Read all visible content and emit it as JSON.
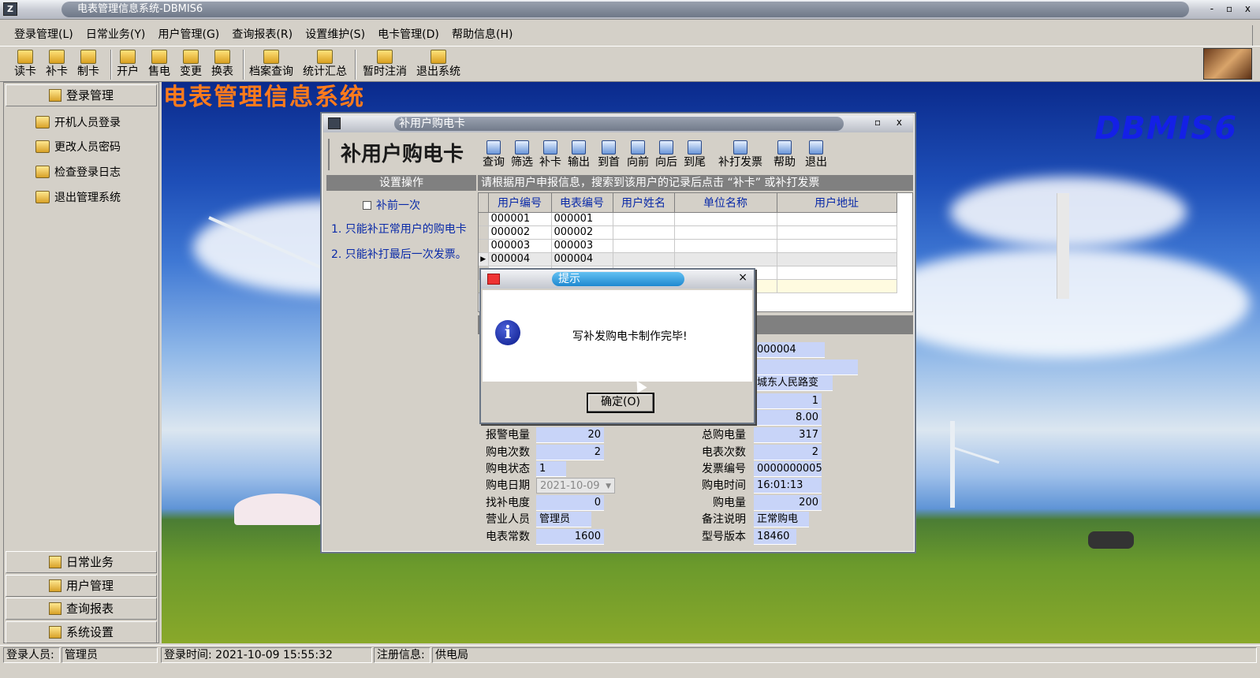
{
  "window": {
    "title": "电表管理信息系统-DBMIS6",
    "logo": "Z",
    "controls": "- ▫ x"
  },
  "menu": [
    "登录管理(L)",
    "日常业务(Y)",
    "用户管理(G)",
    "查询报表(R)",
    "设置维护(S)",
    "电卡管理(D)",
    "帮助信息(H)"
  ],
  "toolbar": {
    "read": "读卡",
    "reissue": "补卡",
    "make": "制卡",
    "open": "开户",
    "sell": "售电",
    "change": "变更",
    "swap": "换表",
    "archive": "档案查询",
    "stats": "统计汇总",
    "logout": "暂时注消",
    "exit": "退出系统"
  },
  "sidebar": {
    "top_header": "登录管理",
    "items": [
      "开机人员登录",
      "更改人员密码",
      "检查登录日志",
      "退出管理系统"
    ],
    "bottom_headers": [
      "日常业务",
      "用户管理",
      "查询报表",
      "系统设置"
    ]
  },
  "desktop": {
    "app_title": "电表管理信息系统",
    "brand": "DBMIS6"
  },
  "child": {
    "title": "补用户购电卡",
    "controls": "▫ x",
    "form_title": "补用户购电卡",
    "toolbar": {
      "query": "查询",
      "filter": "筛选",
      "reissue": "补卡",
      "export": "输出",
      "first": "到首",
      "prev": "向前",
      "next": "向后",
      "last": "到尾",
      "reprint": "补打发票",
      "help": "帮助",
      "exit": "退出"
    },
    "ops_header": "设置操作",
    "checkbox_label": "补前一次",
    "note1": "1. 只能补正常用户的购电卡",
    "note2": "2. 只能补打最后一次发票。",
    "info_header": "请根据用户申报信息，搜索到该用户的记录后点击 “补卡” 或补打发票",
    "columns": [
      "用户编号",
      "电表编号",
      "用户姓名",
      "单位名称",
      "用户地址"
    ],
    "rows": [
      [
        "000001",
        "000001",
        "",
        "",
        ""
      ],
      [
        "000002",
        "000002",
        "",
        "",
        ""
      ],
      [
        "000003",
        "000003",
        "",
        "",
        ""
      ],
      [
        "000004",
        "000004",
        "",
        "",
        ""
      ]
    ],
    "fields_right_partial": [
      "000004",
      "",
      "城东人民路变",
      "1",
      "8.00"
    ],
    "fields_left": [
      {
        "label": "报警电量",
        "value": "20"
      },
      {
        "label": "购电次数",
        "value": "2"
      },
      {
        "label": "购电状态",
        "value": "1"
      },
      {
        "label": "购电日期",
        "value": "2021-10-09"
      },
      {
        "label": "找补电度",
        "value": "0"
      },
      {
        "label": "营业人员",
        "value": "管理员"
      },
      {
        "label": "电表常数",
        "value": "1600"
      }
    ],
    "fields_right": [
      {
        "label": "总购电量",
        "value": "317"
      },
      {
        "label": "电表次数",
        "value": "2"
      },
      {
        "label": "发票编号",
        "value": "0000000005"
      },
      {
        "label": "购电时间",
        "value": "16:01:13"
      },
      {
        "label": "购电量",
        "value": "200"
      },
      {
        "label": "备注说明",
        "value": "正常购电"
      },
      {
        "label": "型号版本",
        "value": "18460"
      }
    ]
  },
  "dialog": {
    "title": "提示",
    "message": "写补发购电卡制作完毕!",
    "ok": "确定(O)",
    "close": "×"
  },
  "status": {
    "user_label": "登录人员:",
    "user": "管理员",
    "login_time": "登录时间: 2021-10-09 15:55:32",
    "reg_label": "注册信息:",
    "reg": "供电局"
  }
}
